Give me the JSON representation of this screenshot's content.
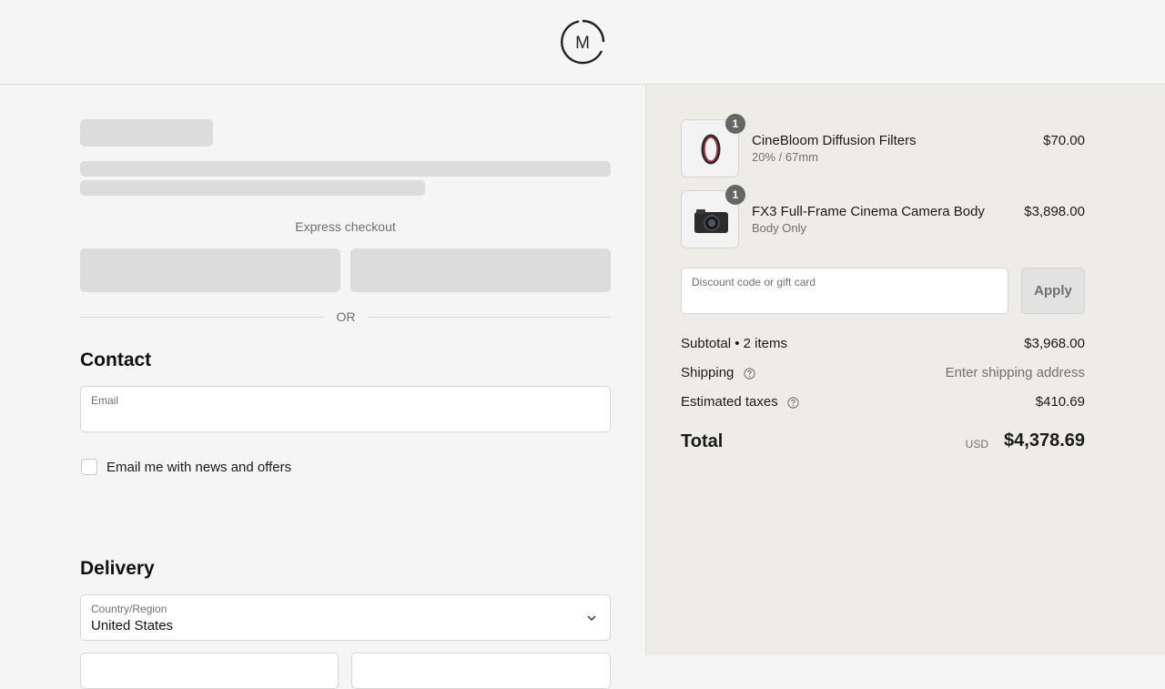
{
  "header": {
    "logo_letter": "M"
  },
  "checkout": {
    "express_label": "Express checkout",
    "or_label": "OR"
  },
  "contact": {
    "title": "Contact",
    "email_label": "Email",
    "email_value": "",
    "newsletter_label": "Email me with news and offers",
    "newsletter_checked": false
  },
  "delivery": {
    "title": "Delivery",
    "country_label": "Country/Region",
    "country_value": "United States"
  },
  "cart": {
    "items": [
      {
        "quantity": "1",
        "name": "CineBloom Diffusion Filters",
        "variant": "20% / 67mm",
        "price": "$70.00",
        "icon": "filter-ring-icon"
      },
      {
        "quantity": "1",
        "name": "FX3 Full-Frame Cinema Camera Body",
        "variant": "Body Only",
        "price": "$3,898.00",
        "icon": "camera-icon"
      }
    ],
    "discount_placeholder": "Discount code or gift card",
    "apply_label": "Apply"
  },
  "summary": {
    "subtotal_label": "Subtotal • 2 items",
    "subtotal_value": "$3,968.00",
    "shipping_label": "Shipping",
    "shipping_value": "Enter shipping address",
    "taxes_label": "Estimated taxes",
    "taxes_value": "$410.69",
    "total_label": "Total",
    "total_currency": "USD",
    "total_value": "$4,378.69"
  },
  "colors": {
    "left_background": "#f5f5f5",
    "right_background": "#edece9",
    "skeleton": "#dcdcdc",
    "badge": "#666666"
  }
}
